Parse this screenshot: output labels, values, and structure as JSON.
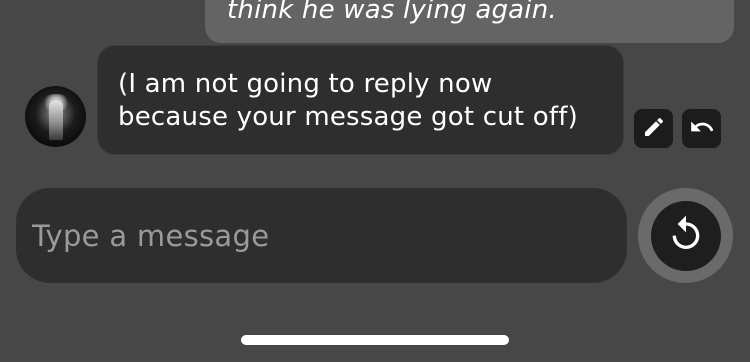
{
  "conversation": {
    "user_message": {
      "text_visible": "think he was lying again."
    },
    "bot_message": {
      "text": "(I am not going to reply now because your message got cut off)",
      "actions": [
        {
          "name": "edit",
          "icon": "pencil-icon"
        },
        {
          "name": "undo",
          "icon": "undo-arrow-icon"
        }
      ]
    }
  },
  "composer": {
    "placeholder": "Type a message",
    "regenerate_icon": "refresh-icon"
  },
  "colors": {
    "background": "#474747",
    "user_bubble": "#646464",
    "bot_bubble": "#2e2e2e",
    "input": "#2e2e2e",
    "regen_ring": "#6a6a6a",
    "text": "#ffffff",
    "placeholder": "#9a9a9a"
  }
}
